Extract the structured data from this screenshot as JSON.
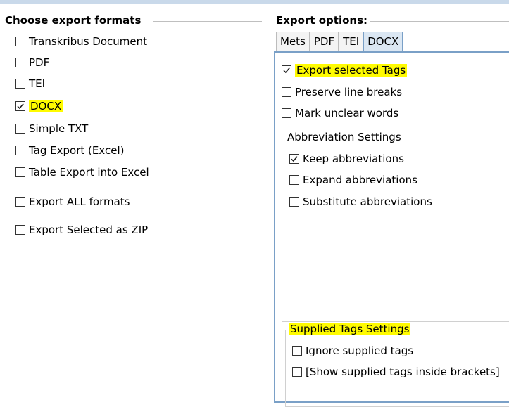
{
  "left_panel": {
    "title": "Choose export formats",
    "formats": [
      {
        "label": "Transkribus Document",
        "checked": false,
        "highlighted": false
      },
      {
        "label": "PDF",
        "checked": false,
        "highlighted": false
      },
      {
        "label": "TEI",
        "checked": false,
        "highlighted": false
      },
      {
        "label": "DOCX",
        "checked": true,
        "highlighted": true
      },
      {
        "label": "Simple TXT",
        "checked": false,
        "highlighted": false
      },
      {
        "label": "Tag Export (Excel)",
        "checked": false,
        "highlighted": false
      },
      {
        "label": "Table Export into Excel",
        "checked": false,
        "highlighted": false
      }
    ],
    "export_all": {
      "label": "Export ALL formats",
      "checked": false
    },
    "export_zip": {
      "label": "Export Selected as ZIP",
      "checked": false
    }
  },
  "right_panel": {
    "title": "Export options:",
    "tabs": [
      {
        "label": "Mets",
        "active": false
      },
      {
        "label": "PDF",
        "active": false
      },
      {
        "label": "TEI",
        "active": false
      },
      {
        "label": "DOCX",
        "active": true
      }
    ],
    "options": [
      {
        "label": "Export selected Tags",
        "checked": true,
        "highlighted": true
      },
      {
        "label": "Preserve line breaks",
        "checked": false,
        "highlighted": false
      },
      {
        "label": "Mark unclear words",
        "checked": false,
        "highlighted": false
      }
    ],
    "abbreviation_settings": {
      "title": "Abbreviation Settings",
      "options": [
        {
          "label": "Keep abbreviations",
          "checked": true
        },
        {
          "label": "Expand abbreviations",
          "checked": false
        },
        {
          "label": "Substitute abbreviations",
          "checked": false
        }
      ]
    },
    "supplied_tags_settings": {
      "title": "Supplied Tags Settings",
      "title_highlighted": true,
      "options": [
        {
          "label": "Ignore supplied tags",
          "checked": false
        },
        {
          "label": "[Show supplied tags inside brackets]",
          "checked": false
        }
      ]
    }
  },
  "colors": {
    "highlight": "#fffb00",
    "active_tab": "#dbe7f3",
    "panel_border": "#7aa0c7",
    "check_mark": "#1a1a1a"
  }
}
